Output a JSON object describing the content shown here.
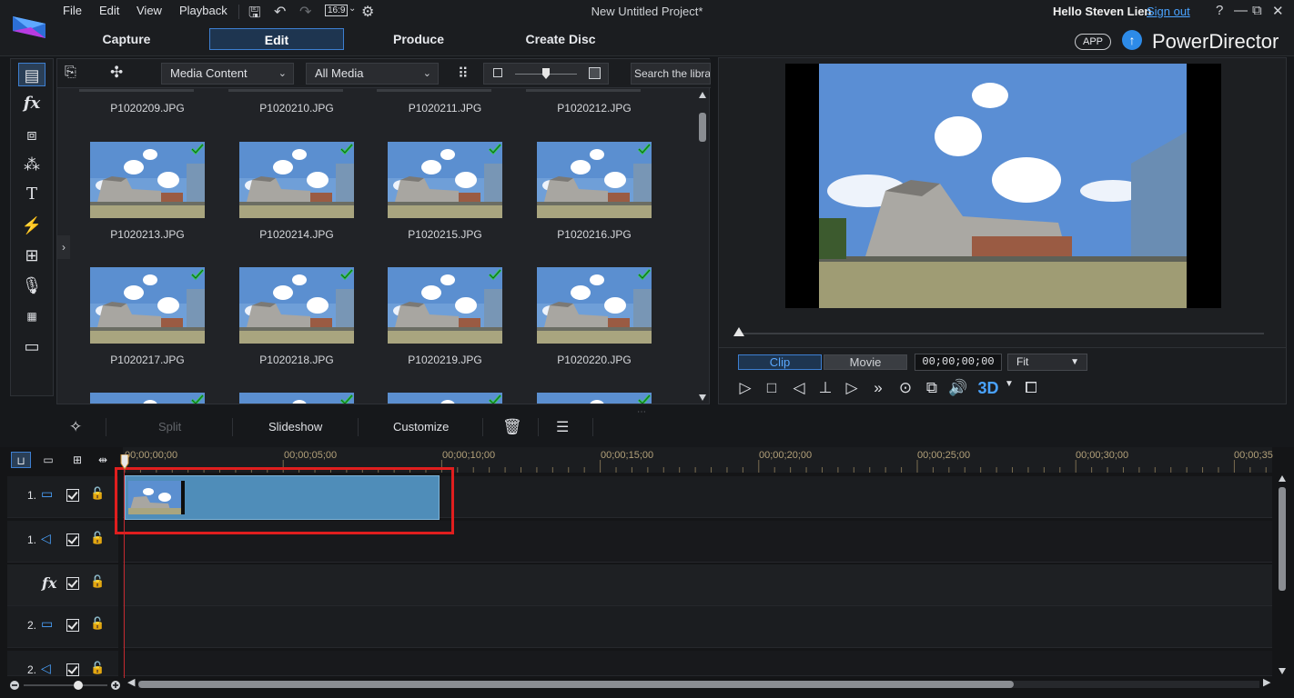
{
  "menu": {
    "file": "File",
    "edit": "Edit",
    "view": "View",
    "playback": "Playback",
    "aspect": "16:9"
  },
  "project_title": "New Untitled Project*",
  "account": {
    "hello": "Hello Steven Lien",
    "signout": "Sign out"
  },
  "window_controls": {
    "help": "?",
    "minimize": "—",
    "restore": "⧉",
    "close": "✕"
  },
  "main_tabs": [
    {
      "label": "Capture"
    },
    {
      "label": "Edit"
    },
    {
      "label": "Produce"
    },
    {
      "label": "Create Disc"
    }
  ],
  "brand": {
    "app_badge": "APP",
    "name": "PowerDirector"
  },
  "rail_icons": [
    "media-room-icon",
    "fx-icon",
    "pip-icon",
    "particle-icon",
    "title-icon",
    "transition-icon",
    "audio-mixing-icon",
    "voiceover-icon",
    "chapter-icon",
    "subtitle-icon"
  ],
  "library": {
    "content_select": "Media Content",
    "filter_select": "All Media",
    "search_placeholder": "Search the library",
    "partial_top_labels": [
      "P1020209.JPG",
      "P1020210.JPG",
      "P1020211.JPG",
      "P1020212.JPG"
    ],
    "rows": [
      [
        "P1020213.JPG",
        "P1020214.JPG",
        "P1020215.JPG",
        "P1020216.JPG"
      ],
      [
        "P1020217.JPG",
        "P1020218.JPG",
        "P1020219.JPG",
        "P1020220.JPG"
      ]
    ]
  },
  "preview": {
    "mode_clip": "Clip",
    "mode_movie": "Movie",
    "timecode": "00;00;00;00",
    "fit": "Fit",
    "btn_3d": "3D"
  },
  "edit_toolbar": {
    "split": "Split",
    "slideshow": "Slideshow",
    "customize": "Customize"
  },
  "timeline": {
    "ruler_labels": [
      "00;00;00;00",
      "00;00;05;00",
      "00;00;10;00",
      "00;00;15;00",
      "00;00;20;00",
      "00;00;25;00",
      "00;00;30;00",
      "00;00;35"
    ],
    "tracks": [
      {
        "num": "1.",
        "kind": "video"
      },
      {
        "num": "1.",
        "kind": "audio"
      },
      {
        "num": "",
        "kind": "fx"
      },
      {
        "num": "2.",
        "kind": "video"
      },
      {
        "num": "2.",
        "kind": "audio"
      }
    ]
  },
  "colors": {
    "accent": "#3d7fd1",
    "clip": "#4f8db9",
    "highlight": "#e01e1e",
    "playhead": "#c0272d",
    "ruler_text": "#b2a079"
  }
}
